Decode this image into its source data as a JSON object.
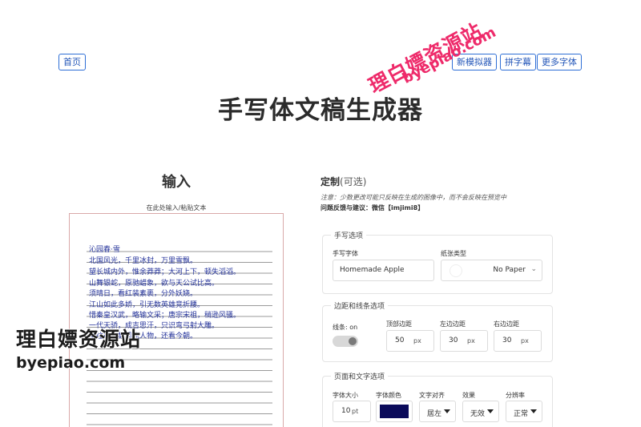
{
  "nav": {
    "home": "首页",
    "new_simulator": "新模拟器",
    "pinyin": "拼字幕",
    "more_fonts": "更多字体"
  },
  "watermark": {
    "top_line1": "理白嫖资源站",
    "top_line2": "byepiao.com",
    "bottom_line1": "理白嫖资源站",
    "bottom_line2": "byepiao.com"
  },
  "title": "手写体文稿生成器",
  "input": {
    "heading": "输入",
    "hint": "在此处输入/粘贴文本",
    "lines": [
      "沁园春·雪",
      "北国风光，千里冰封，万里雪飘。",
      "望长城内外，惟余莽莽；大河上下，顿失滔滔。",
      "山舞银蛇，原驰蜡象，欲与天公试比高。",
      "须晴日，看红装素裹，分外妖娆。",
      "江山如此多娇，引无数英雄竞折腰。",
      "惜秦皇汉武，略输文采；唐宗宋祖，稍逊风骚。",
      "一代天骄，成吉思汗，只识弯弓射大雕。",
      "俱往矣，数风流人物，还看今朝。"
    ]
  },
  "custom": {
    "heading": "定制",
    "optional": "(可选)",
    "notice": "注意：少数更改可能只反映在生成的图像中，而不会反映在预览中",
    "feedback": "问题反馈与建议：微信【imjimi8】"
  },
  "handwriting": {
    "legend": "手写选项",
    "font_label": "手写字体",
    "font_value": "Homemade Apple",
    "paper_label": "纸张类型",
    "paper_value": "No Paper"
  },
  "margins": {
    "legend": "边距和线条选项",
    "lines_label": "线条: on",
    "top_label": "顶部边距",
    "top_value": "50",
    "left_label": "左边边距",
    "left_value": "30",
    "right_label": "右边边距",
    "right_value": "30",
    "unit": "px"
  },
  "page": {
    "legend": "页面和文字选项",
    "size_label": "字体大小",
    "size_value": "10",
    "size_unit": "pt",
    "color_label": "字体颜色",
    "ink_color": "#0a0a5a",
    "align_label": "文字对齐",
    "align_value": "居左",
    "effect_label": "效果",
    "effect_value": "无效",
    "resolution_label": "分辨率",
    "resolution_value": "正常"
  }
}
